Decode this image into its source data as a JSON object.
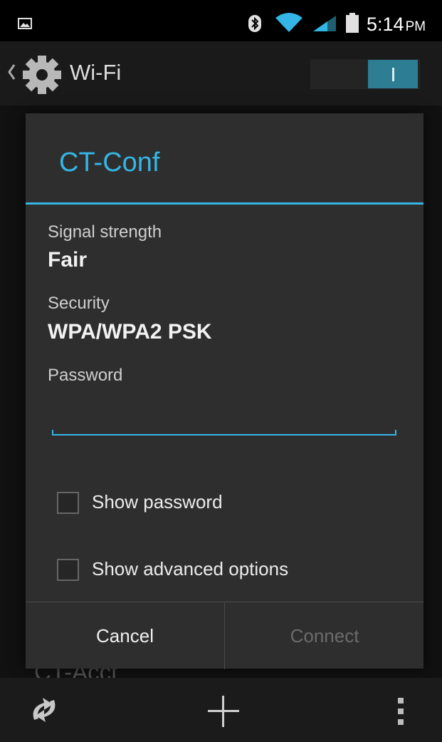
{
  "status_bar": {
    "time": "5:14",
    "ampm": "PM",
    "icons": [
      "image-notification-icon",
      "bluetooth-icon",
      "wifi-signal-icon",
      "cell-signal-icon",
      "battery-icon"
    ]
  },
  "action_bar": {
    "title": "Wi-Fi",
    "wifi_enabled": true,
    "switch_label": "I"
  },
  "background_list": {
    "partial_item": "CT-Acct"
  },
  "dialog": {
    "title": "CT-Conf",
    "signal_label": "Signal strength",
    "signal_value": "Fair",
    "security_label": "Security",
    "security_value": "WPA/WPA2 PSK",
    "password_label": "Password",
    "password_value": "",
    "show_password_label": "Show password",
    "show_password_checked": false,
    "advanced_label": "Show advanced options",
    "advanced_checked": false,
    "cancel_label": "Cancel",
    "connect_label": "Connect",
    "connect_enabled": false
  },
  "bottom_bar": {
    "icons": [
      "scan-icon",
      "add-network-icon",
      "overflow-menu-icon"
    ]
  },
  "colors": {
    "accent": "#35b5e5",
    "dialog_bg": "#2e2e2e",
    "switch_on": "#2d7d93"
  }
}
